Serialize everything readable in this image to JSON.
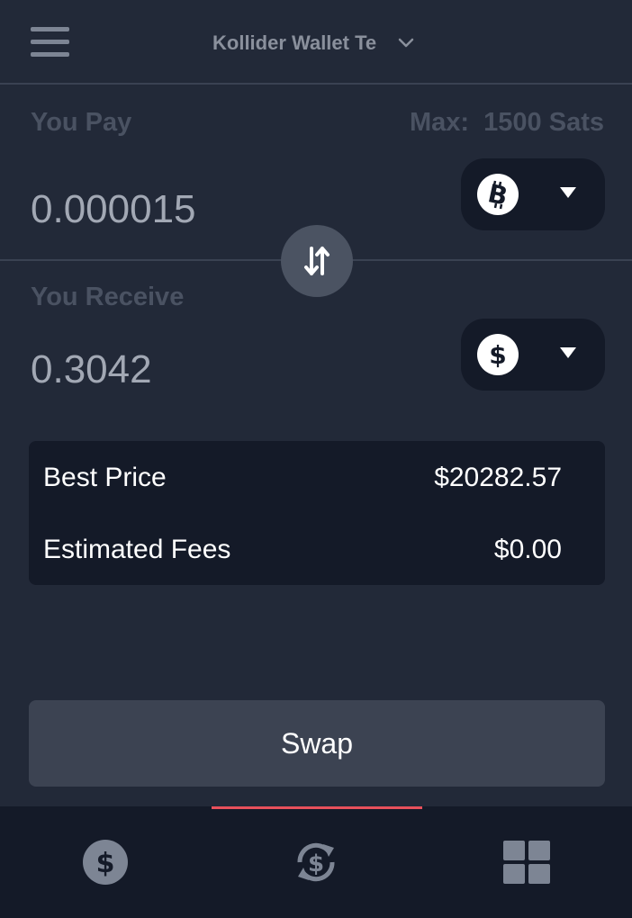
{
  "header": {
    "wallet_name": "Kollider Wallet Te"
  },
  "pay": {
    "label": "You Pay",
    "max_label": "Max:  1500 Sats",
    "amount": "0.000015",
    "currency_icon": "bitcoin-icon"
  },
  "receive": {
    "label": "You Receive",
    "amount": "0.3042",
    "currency_icon": "dollar-icon"
  },
  "price_info": {
    "best_price_label": "Best Price",
    "best_price_value": "$20282.57",
    "fees_label": "Estimated Fees",
    "fees_value": "$0.00"
  },
  "swap_button_label": "Swap",
  "bottom_nav": {
    "items": [
      {
        "icon": "dollar-circle-icon",
        "active": false
      },
      {
        "icon": "swap-dollar-icon",
        "active": true
      },
      {
        "icon": "grid-icon",
        "active": false
      }
    ],
    "active_indicator_color": "#e8505b"
  },
  "colors": {
    "background": "#222938",
    "panel": "#141a28",
    "button": "#3c4352"
  }
}
